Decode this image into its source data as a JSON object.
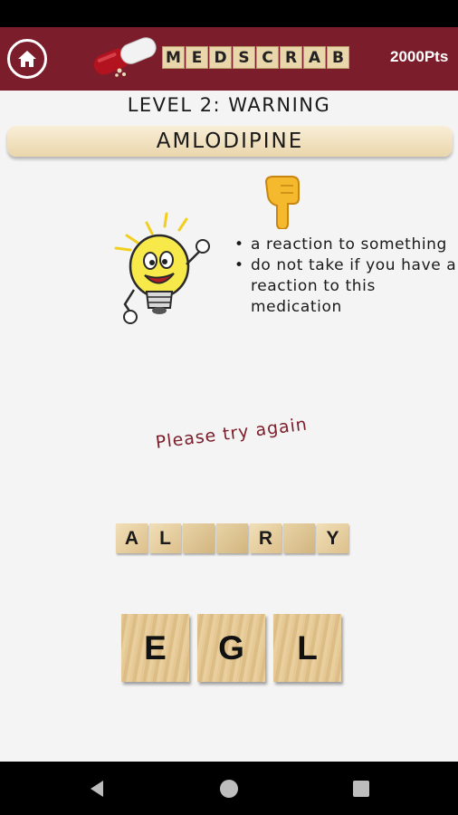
{
  "header": {
    "brand_letters": [
      "M",
      "E",
      "D",
      "S",
      "C",
      "R",
      "A",
      "B"
    ],
    "points": "2000Pts",
    "home_icon": "home-icon",
    "logo_icon": "pill-capsule-icon",
    "bg_color": "#7b1d2a"
  },
  "level": {
    "title": "LEVEL 2: WARNING",
    "drug_name": "AMLODIPINE"
  },
  "hints": [
    "a reaction to something",
    "do not take if you have a reaction to this medication"
  ],
  "feedback": "Please try again",
  "answer_slots": [
    "A",
    "L",
    "",
    "",
    "R",
    "",
    "Y"
  ],
  "choices": [
    "E",
    "G",
    "L"
  ],
  "nav": {
    "back_icon": "back-triangle-icon",
    "home_icon": "home-circle-icon",
    "recents_icon": "recents-square-icon"
  }
}
